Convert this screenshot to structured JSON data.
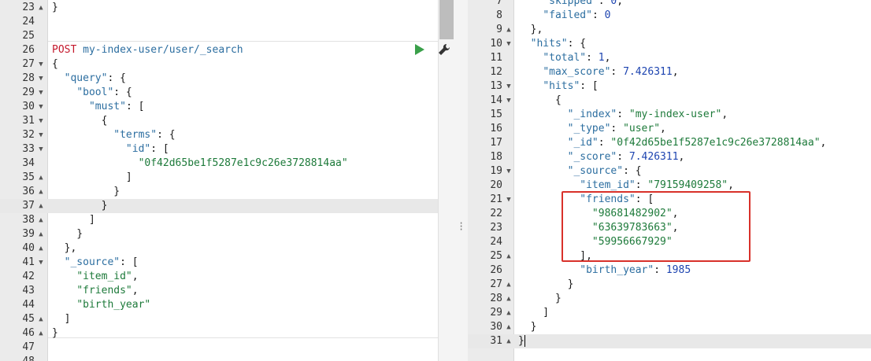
{
  "colors": {
    "method": "#c4182c",
    "key": "#2c6ea0",
    "string": "#1d7a3a",
    "number": "#1d44b0",
    "highlight_border": "#d8312a",
    "run_button": "#3aa04a"
  },
  "request": {
    "method": "POST",
    "path": "my-index-user/user/_search"
  },
  "left_lines": [
    {
      "n": "23",
      "fold": "▲",
      "t": "}"
    },
    {
      "n": "24",
      "fold": "",
      "t": ""
    },
    {
      "n": "25",
      "fold": "",
      "t": ""
    },
    {
      "n": "26",
      "fold": "",
      "t": ""
    },
    {
      "n": "27",
      "fold": "▼",
      "t": "{"
    },
    {
      "n": "28",
      "fold": "▼",
      "t": "  \"query\": {"
    },
    {
      "n": "29",
      "fold": "▼",
      "t": "    \"bool\": {"
    },
    {
      "n": "30",
      "fold": "▼",
      "t": "      \"must\": ["
    },
    {
      "n": "31",
      "fold": "▼",
      "t": "        {"
    },
    {
      "n": "32",
      "fold": "▼",
      "t": "          \"terms\": {"
    },
    {
      "n": "33",
      "fold": "▼",
      "t": "            \"id\": ["
    },
    {
      "n": "34",
      "fold": "",
      "t": "              \"0f42d65be1f5287e1c9c26e3728814aa\""
    },
    {
      "n": "35",
      "fold": "▲",
      "t": "            ]"
    },
    {
      "n": "36",
      "fold": "▲",
      "t": "          }"
    },
    {
      "n": "37",
      "fold": "▲",
      "t": "        }"
    },
    {
      "n": "38",
      "fold": "▲",
      "t": "      ]"
    },
    {
      "n": "39",
      "fold": "▲",
      "t": "    }"
    },
    {
      "n": "40",
      "fold": "▲",
      "t": "  },"
    },
    {
      "n": "41",
      "fold": "▼",
      "t": "  \"_source\": ["
    },
    {
      "n": "42",
      "fold": "",
      "t": "    \"item_id\","
    },
    {
      "n": "43",
      "fold": "",
      "t": "    \"friends\","
    },
    {
      "n": "44",
      "fold": "",
      "t": "    \"birth_year\""
    },
    {
      "n": "45",
      "fold": "▲",
      "t": "  ]"
    },
    {
      "n": "46",
      "fold": "▲",
      "t": "}"
    },
    {
      "n": "47",
      "fold": "",
      "t": ""
    },
    {
      "n": "48",
      "fold": "",
      "t": ""
    }
  ],
  "right_lines": [
    {
      "n": "7",
      "fold": "",
      "t": "    \"skipped\": 0,"
    },
    {
      "n": "8",
      "fold": "",
      "t": "    \"failed\": 0"
    },
    {
      "n": "9",
      "fold": "▲",
      "t": "  },"
    },
    {
      "n": "10",
      "fold": "▼",
      "t": "  \"hits\": {"
    },
    {
      "n": "11",
      "fold": "",
      "t": "    \"total\": 1,"
    },
    {
      "n": "12",
      "fold": "",
      "t": "    \"max_score\": 7.426311,"
    },
    {
      "n": "13",
      "fold": "▼",
      "t": "    \"hits\": ["
    },
    {
      "n": "14",
      "fold": "▼",
      "t": "      {"
    },
    {
      "n": "15",
      "fold": "",
      "t": "        \"_index\": \"my-index-user\","
    },
    {
      "n": "16",
      "fold": "",
      "t": "        \"_type\": \"user\","
    },
    {
      "n": "17",
      "fold": "",
      "t": "        \"_id\": \"0f42d65be1f5287e1c9c26e3728814aa\","
    },
    {
      "n": "18",
      "fold": "",
      "t": "        \"_score\": 7.426311,"
    },
    {
      "n": "19",
      "fold": "▼",
      "t": "        \"_source\": {"
    },
    {
      "n": "20",
      "fold": "",
      "t": "          \"item_id\": \"79159409258\","
    },
    {
      "n": "21",
      "fold": "▼",
      "t": "          \"friends\": ["
    },
    {
      "n": "22",
      "fold": "",
      "t": "            \"98681482902\","
    },
    {
      "n": "23",
      "fold": "",
      "t": "            \"63639783663\","
    },
    {
      "n": "24",
      "fold": "",
      "t": "            \"59956667929\""
    },
    {
      "n": "25",
      "fold": "▲",
      "t": "          ],"
    },
    {
      "n": "26",
      "fold": "",
      "t": "          \"birth_year\": 1985"
    },
    {
      "n": "27",
      "fold": "▲",
      "t": "        }"
    },
    {
      "n": "28",
      "fold": "▲",
      "t": "      }"
    },
    {
      "n": "29",
      "fold": "▲",
      "t": "    ]"
    },
    {
      "n": "30",
      "fold": "▲",
      "t": "  }"
    },
    {
      "n": "31",
      "fold": "▲",
      "t": "}"
    }
  ]
}
